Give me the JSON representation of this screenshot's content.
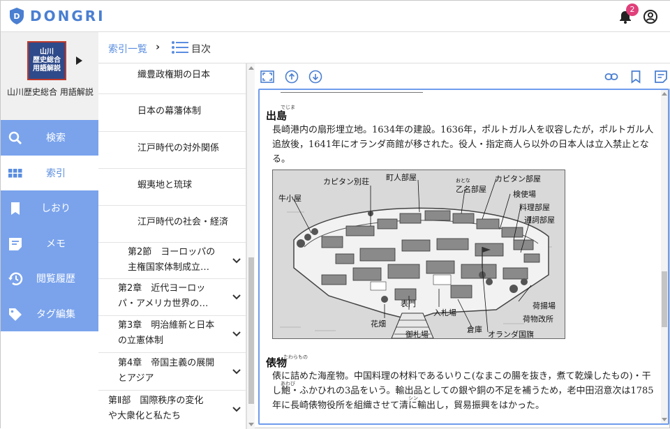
{
  "app": {
    "name": "DONGRI",
    "brand_color": "#4a7fd1",
    "notification_count": "2"
  },
  "book": {
    "cover_text": [
      "山川",
      "歴史総合",
      "用語解説"
    ],
    "title": "山川歴史総合 用語解説"
  },
  "nav": {
    "items": [
      {
        "label": "検索",
        "icon": "search-icon"
      },
      {
        "label": "索引",
        "icon": "grid-icon",
        "active": true
      },
      {
        "label": "しおり",
        "icon": "bookmark-icon"
      },
      {
        "label": "メモ",
        "icon": "memo-icon"
      },
      {
        "label": "閲覧履歴",
        "icon": "history-icon"
      },
      {
        "label": "タグ編集",
        "icon": "tag-icon"
      }
    ]
  },
  "breadcrumb": {
    "link": "索引一覧",
    "separator": "›",
    "current": "目次"
  },
  "toc": {
    "items": [
      {
        "label": "織豊政権期の日本"
      },
      {
        "label": "日本の幕藩体制"
      },
      {
        "label": "江戸時代の対外関係"
      },
      {
        "label": "蝦夷地と琉球"
      },
      {
        "label": "江戸時代の社会・経済"
      },
      {
        "line1": "第2節　ヨーロッパの",
        "line2": "主権国家体制成立…"
      },
      {
        "line1": "第2章　近代ヨーロッ",
        "line2": "パ・アメリカ世界の…"
      },
      {
        "line1": "第3章　明治維新と日本",
        "line2": "の立憲体制"
      },
      {
        "line1": "第4章　帝国主義の展開",
        "line2": "とアジア"
      },
      {
        "line1": "第Ⅱ部　国際秩序の変化",
        "line2": "や大衆化と私たち"
      }
    ]
  },
  "reader": {
    "entry1": {
      "heading": "出島",
      "ruby": "でじま",
      "lines": [
        "長崎港内の扇形埋立地。1634年の建設。1636年，ポルトガル人を収容したが，ポルトガル人",
        "追放後，1641年にオランダ商館が移された。役人・指定商人ら以外の日本人は立入禁止とな",
        "る。"
      ]
    },
    "figure": {
      "labels": {
        "capitan_villa": "カピタン別荘",
        "machinin": "町人部屋",
        "capitan_room": "カピタン部屋",
        "otona": "乙名部屋",
        "otona_ruby": "おとな",
        "kenshi": "検使場",
        "ushigoya": "牛小屋",
        "ryori": "料理部屋",
        "tsuji": "通詞部屋",
        "omotemon": "表門",
        "nyusatsu": "入札場",
        "niage": "荷揚場",
        "nimotsu": "荷物改所",
        "hanabata": "花畑",
        "souko": "倉庫",
        "gosatsu": "御札場",
        "flag": "オランダ国旗"
      }
    },
    "entry2": {
      "heading": "俵物",
      "ruby": "たわらもの",
      "lines": [
        "俵に詰めた海産物。中国料理の材料であるいりこ(なまこの腸を抜き，煮て乾燥したもの)・干",
        "し鮑・ふかひれの3品をいう。輸出品としての銀や銅の不足を補うため，老中田沼意次は1785",
        "年に長崎俵物役所を組織させて清に輸出し，貿易振興をはかった。"
      ],
      "ruby_awabi": "あわび",
      "ruby_shin": "シン"
    }
  }
}
